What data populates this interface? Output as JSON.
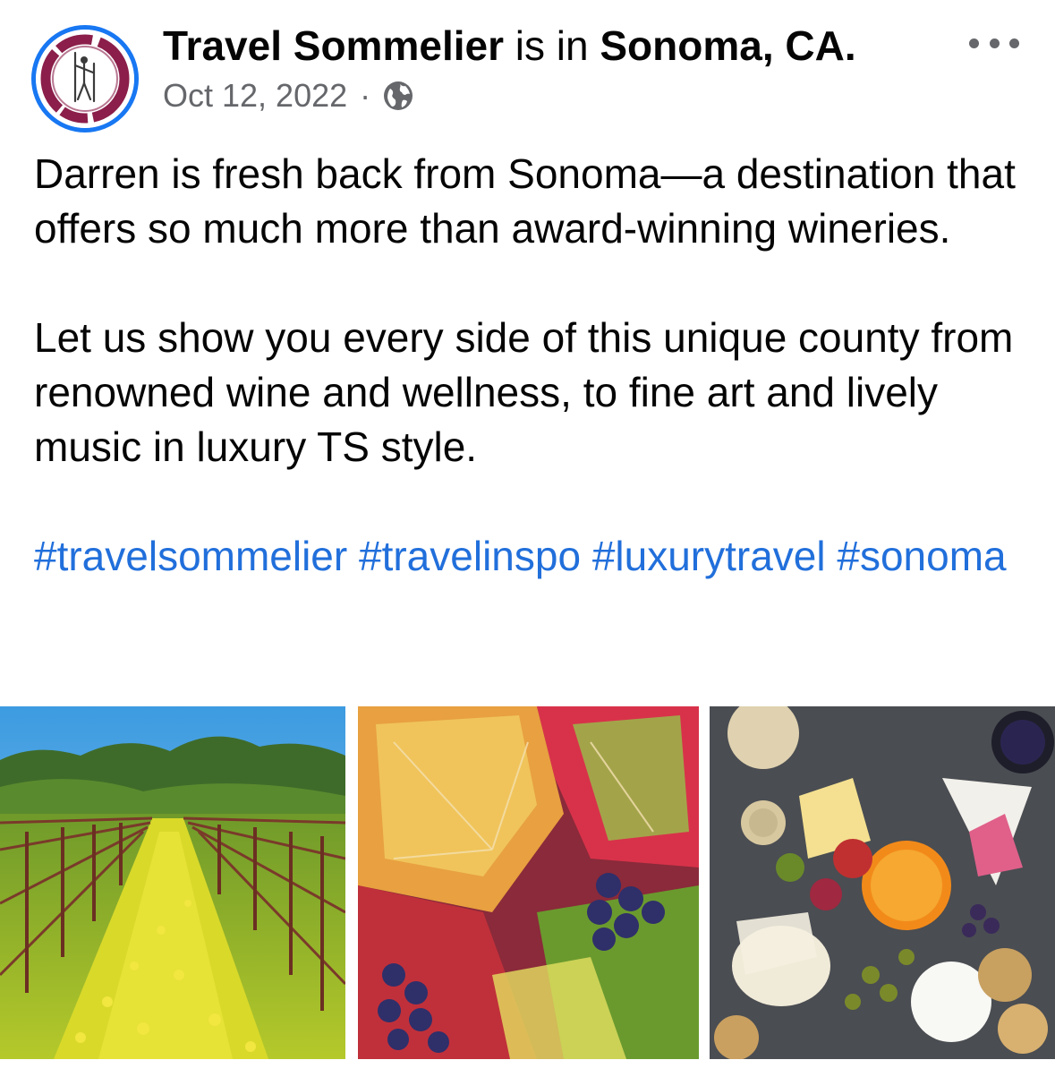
{
  "post": {
    "author": "Travel Sommelier",
    "location_prefix": "is in",
    "location": "Sonoma, CA.",
    "date": "Oct 12, 2022",
    "separator": "·",
    "privacy_icon": "globe-icon",
    "more_icon": "more-options-icon",
    "body_paragraphs": [
      "Darren is fresh back from Sonoma—a destination that offers so much more than award-winning wineries.",
      "Let us show you every side of this unique county from renowned wine and wellness, to fine art and lively music in luxury TS style."
    ],
    "hashtags": [
      "#travelsommelier",
      "#travelinspo",
      "#luxurytravel",
      "#sonoma"
    ],
    "hashtag_color": "#216fdb",
    "avatar_ring_color": "#1877f2",
    "logo_color": "#8b1e4a"
  },
  "photos": [
    {
      "subject": "vineyard-rows-mustard-flowers"
    },
    {
      "subject": "autumn-grape-leaves-and-grapes"
    },
    {
      "subject": "charcuterie-board"
    }
  ]
}
